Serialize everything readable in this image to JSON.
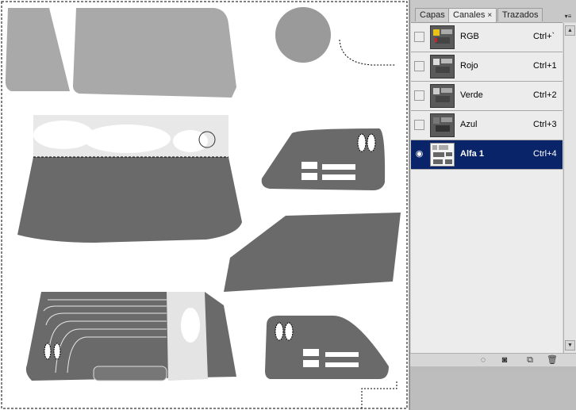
{
  "panel": {
    "tabs": [
      {
        "label": "Capas",
        "active": false
      },
      {
        "label": "Canales",
        "active": true,
        "close": "×"
      },
      {
        "label": "Trazados",
        "active": false
      }
    ],
    "menu_icon": "panel-menu-icon"
  },
  "channels": [
    {
      "name": "RGB",
      "shortcut": "Ctrl+`",
      "visible": false,
      "selected": false
    },
    {
      "name": "Rojo",
      "shortcut": "Ctrl+1",
      "visible": false,
      "selected": false
    },
    {
      "name": "Verde",
      "shortcut": "Ctrl+2",
      "visible": false,
      "selected": false
    },
    {
      "name": "Azul",
      "shortcut": "Ctrl+3",
      "visible": false,
      "selected": false
    },
    {
      "name": "Alfa 1",
      "shortcut": "Ctrl+4",
      "visible": true,
      "selected": true
    }
  ],
  "bottom_icons": [
    "load-selection-icon",
    "save-selection-icon",
    "new-channel-icon",
    "delete-channel-icon"
  ],
  "colors": {
    "selection_highlight": "#0a246a",
    "mask_gray": "#6a6a6a",
    "light_gray": "#a8a8a8"
  }
}
